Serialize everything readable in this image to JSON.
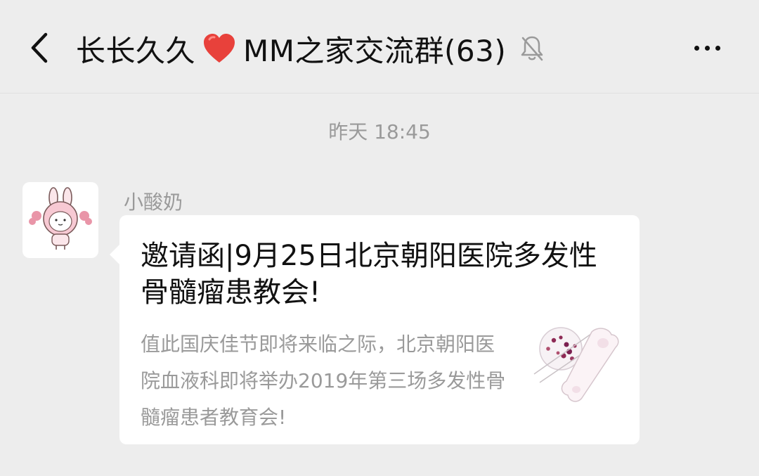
{
  "header": {
    "title_prefix": "长长久久",
    "title_suffix": "MM之家交流群(63)"
  },
  "chat": {
    "timestamp": "昨天 18:45",
    "messages": [
      {
        "sender": "小酸奶",
        "card": {
          "title": "邀请函|9月25日北京朝阳医院多发性骨髓瘤患教会!",
          "description": "值此国庆佳节即将来临之际，北京朝阳医院血液科即将举办2019年第三场多发性骨髓瘤患者教育会!"
        }
      }
    ]
  },
  "icons": {
    "back": "chevron-left-icon",
    "heart": "heart-icon",
    "mute": "bell-off-icon",
    "more": "more-horizontal-icon"
  },
  "colors": {
    "background": "#ededed",
    "bubble": "#ffffff",
    "muted_text": "#9a9a9a",
    "heart": "#e8413b"
  }
}
